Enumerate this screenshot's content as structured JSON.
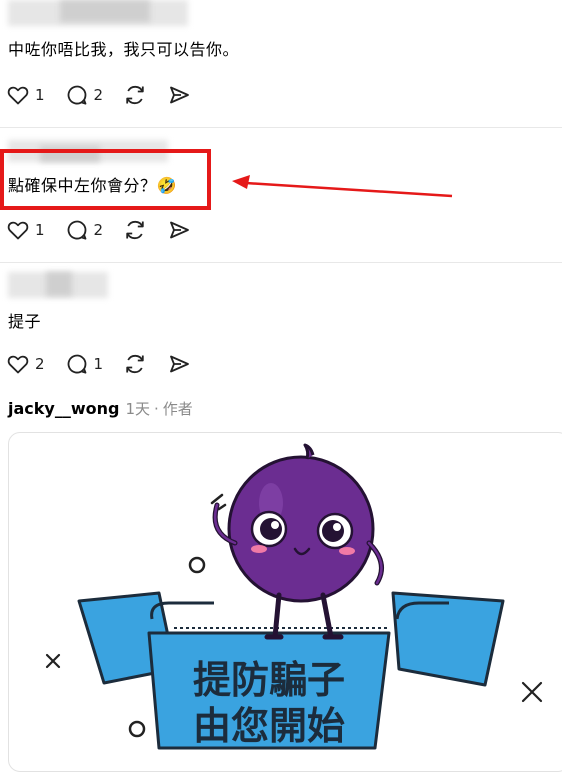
{
  "posts": [
    {
      "text": "中咗你唔比我，我只可以告你。",
      "likes": "1",
      "replies": "2"
    },
    {
      "text": "點確保中左你會分？",
      "emoji": "🤣",
      "likes": "1",
      "replies": "2"
    },
    {
      "text": "提子",
      "likes": "2",
      "replies": "1"
    }
  ],
  "author_post": {
    "username": "jacky__wong",
    "time": "1天",
    "separator": "·",
    "role": "作者",
    "image": {
      "line1": "提防騙子",
      "line2": "由您開始"
    }
  },
  "colors": {
    "highlight": "#e51919",
    "grape": "#6b2d91",
    "banner": "#3aa3e0"
  },
  "icons": [
    "heart-icon",
    "comment-icon",
    "repost-icon",
    "share-icon"
  ]
}
